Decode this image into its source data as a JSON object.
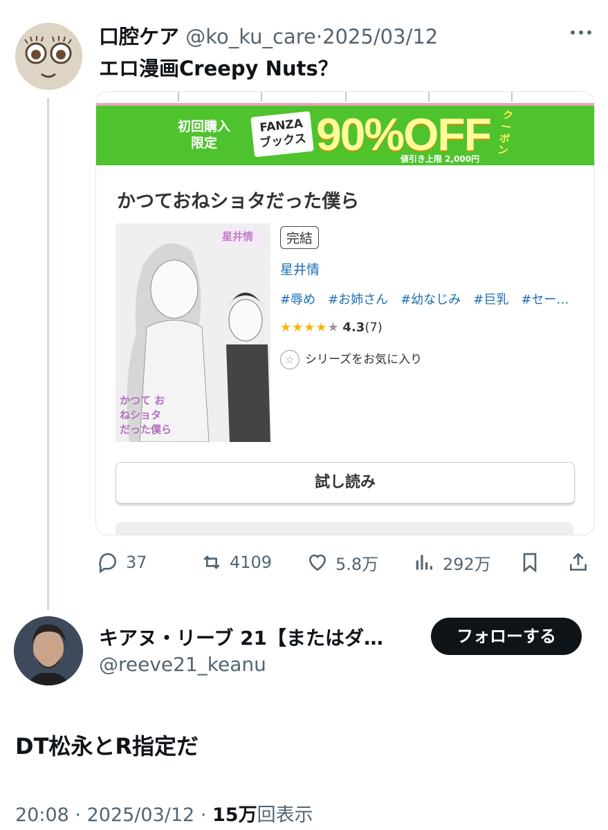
{
  "tweet1": {
    "author_name": "口腔ケア",
    "handle": "@ko_ku_care",
    "separator": "·",
    "date": "2025/03/12",
    "text": "エロ漫画Creepy Nuts？",
    "more_icon": "more-horizontal-icon",
    "card": {
      "banner": {
        "line1": "初回購入",
        "line2": "限定",
        "box_line1": "FANZA",
        "box_line2": "ブックス",
        "big": "90%OFF",
        "cap": "値引き上限 2,000円",
        "coupon": "クーポン"
      },
      "book_title": "かつておねショタだった僕ら",
      "cover_text": "かつて おねショタ だった僕ら",
      "cover_author_tag": "星井情",
      "status_badge": "完結",
      "author": "星井情",
      "tags": "#辱め　#お姉さん　#幼なじみ　#巨乳　#セー…",
      "stars": "★★★★",
      "half_star": "★",
      "rating": "4.3",
      "review_count": "(7)",
      "favorite_label": "シリーズをお気に入り",
      "trial_label": "試し読み"
    },
    "actions": {
      "replies": "37",
      "retweets": "4109",
      "likes": "5.8万",
      "views": "292万"
    }
  },
  "tweet2": {
    "author_name": "キアヌ・リーブ 21【またはダ…",
    "handle": "@reeve21_keanu",
    "follow_label": "フォローする",
    "text": "DT松永とR指定だ",
    "time": "20:08",
    "separator": "·",
    "date": "2025/03/12",
    "views_count": "15万",
    "views_label": "回表示"
  },
  "colors": {
    "text": "#0f1419",
    "muted": "#536471",
    "banner_green": "#4ec32d",
    "link_blue": "#1a6fb4",
    "star": "#f6b500"
  }
}
